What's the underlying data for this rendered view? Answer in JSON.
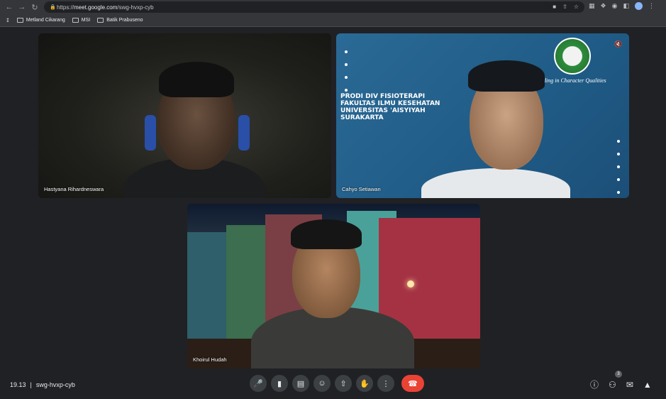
{
  "browser": {
    "url_scheme": "https://",
    "url_host": "meet.google.com",
    "url_path": "/swg-hvxp-cyb",
    "bookmarks": [
      {
        "label": "Metland Cikarang"
      },
      {
        "label": "MSI"
      },
      {
        "label": "Batik Prabuseno"
      }
    ]
  },
  "participants": [
    {
      "name": "Hastyana Rihardneswara"
    },
    {
      "name": "Cahyo Setiawan"
    },
    {
      "name": "Khoirul Hudah"
    }
  ],
  "tile2": {
    "banner_lines": [
      "PRODI DIV FISIOTERAPI",
      "FAKULTAS ILMU KESEHATAN",
      "UNIVERSITAS 'AISYIYAH SURAKARTA"
    ],
    "motto": "...ding in Character Qualities"
  },
  "meeting": {
    "time": "19.13",
    "separator": "|",
    "code": "swg-hvxp-cyb",
    "participant_count": "3"
  },
  "colors": {
    "background": "#202124",
    "hangup": "#ea4335",
    "control": "#3c4043"
  }
}
